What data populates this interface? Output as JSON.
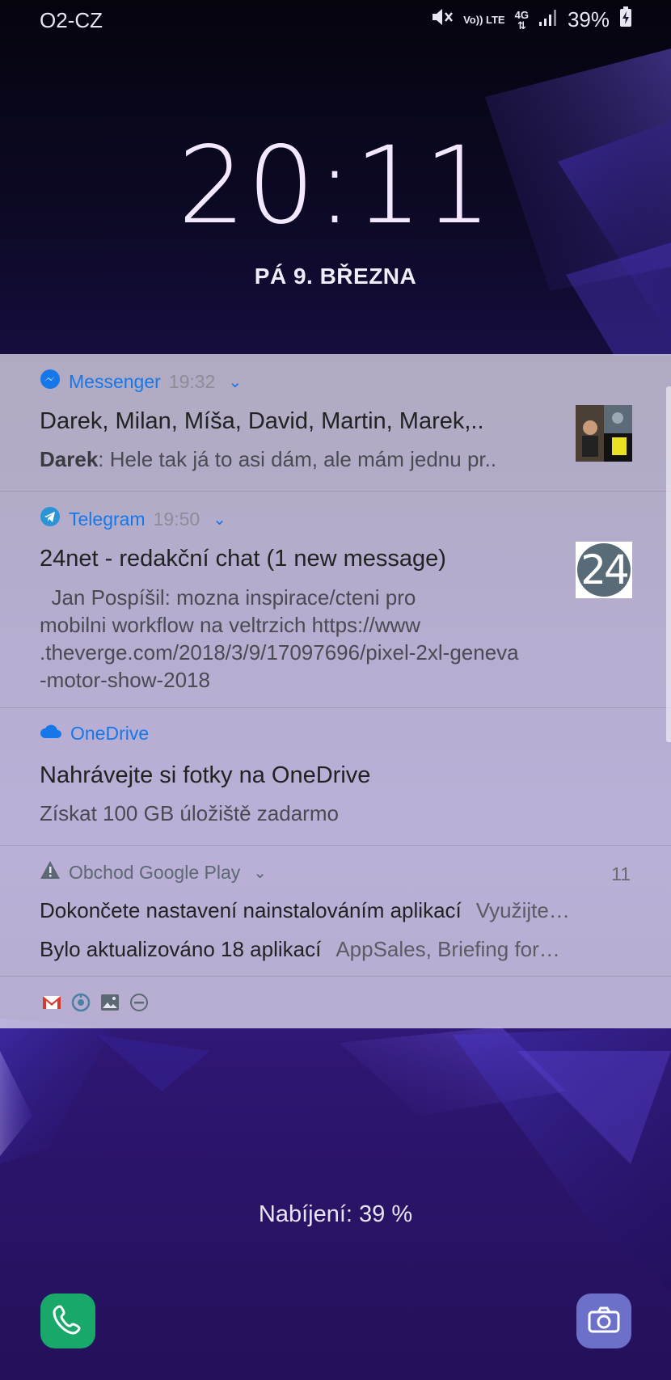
{
  "status_bar": {
    "carrier": "O2-CZ",
    "volte_label": "Vo)) LTE",
    "network_label": "4G",
    "battery_percent": "39%",
    "icons": [
      "mute-icon",
      "volte-icon",
      "4g-icon",
      "signal-icon",
      "battery-charging-icon"
    ]
  },
  "lockscreen": {
    "time": "20:11",
    "date": "PÁ 9. BŘEZNA",
    "charging_text": "Nabíjení: 39 %"
  },
  "notifications": [
    {
      "app": "Messenger",
      "time": "19:32",
      "icon": "messenger-icon",
      "title": "Darek, Milan, Míša, David, Martin, Marek,..",
      "body_sender": "Darek",
      "body_text": ": Hele tak já to asi dám, ale mám jednu pr.."
    },
    {
      "app": "Telegram",
      "time": "19:50",
      "icon": "telegram-icon",
      "title": "24net - redakční chat (1 new message)",
      "body_lines": [
        "  Jan Pospíšil: mozna inspirace/cteni pro",
        "mobilni workflow na veltrzich https://www",
        ".theverge.com/2018/3/9/17097696/pixel-2xl-geneva",
        "-motor-show-2018"
      ],
      "thumb_label": "24"
    },
    {
      "app": "OneDrive",
      "icon": "cloud-icon",
      "title": "Nahrávejte si fotky na OneDrive",
      "body_text": "Získat 100 GB úložiště zadarmo"
    },
    {
      "app": "Obchod Google Play",
      "icon": "warning-icon",
      "count": "11",
      "rows": [
        {
          "title": "Dokončete nastavení nainstalováním aplikací",
          "sub": "Využijte…"
        },
        {
          "title": "Bylo aktualizováno 18 aplikací",
          "sub": "AppSales, Briefing for…"
        }
      ]
    }
  ],
  "icon_strip": [
    "gmail-icon",
    "sync-icon",
    "gallery-icon",
    "do-not-disturb-icon"
  ],
  "colors": {
    "accent_blue": "#1677e8",
    "phone_green": "#17a86a",
    "camera_purple": "#6d70c8"
  }
}
